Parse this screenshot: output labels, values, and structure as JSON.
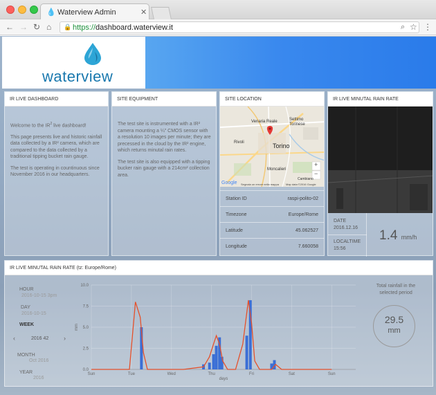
{
  "browser": {
    "tab_title": "Waterview Admin",
    "url_scheme": "https://",
    "url_host": "dashboard.waterview.it"
  },
  "header": {
    "logo_text": "waterview"
  },
  "panels": {
    "dashboard": {
      "title": "IR LIVE DASHBOARD",
      "p1_a": "Welcome to the IR",
      "p1_sup": "2",
      "p1_b": " live dashboard!",
      "p2": "This page presents live and historic rainfall data collected by a IR² camera, which are compared to the data collected by a traditional tipping bucket rain gauge.",
      "p3": "The test is operating in countinuous since November 2016 in our headquarters."
    },
    "equipment": {
      "title": "SITE EQUIPMENT",
      "p1": "The test site is instrumented with a IR² camera mounting a ¼\" CMOS sensor with a resolution 10 images per minute; they are precessed in the cloud by the IR² engine, which returns minutal rain rates.",
      "p2": "The test site is also equipped with a tipping bucker rain gauge with a 214cm² collection area."
    },
    "location": {
      "title": "SITE LOCATION",
      "map_labels": {
        "venaria": "Venaria Reale",
        "settimo": "Settimo Torinese",
        "rivoli": "Rivoli",
        "torino": "Torino",
        "moncalieri": "Moncalieri",
        "cambiano": "Cambiano",
        "google": "Google",
        "attribution": "Map data ©2016 Google",
        "error_link": "Segnala un errore nella mappa",
        "zoom_in": "+",
        "zoom_out": "−"
      },
      "rows": [
        {
          "key": "Station ID",
          "value": "raspi-polito-02"
        },
        {
          "key": "Timezone",
          "value": "Europe/Rome"
        },
        {
          "key": "Latitude",
          "value": "45.062527"
        },
        {
          "key": "Longitude",
          "value": "7.660058"
        }
      ]
    },
    "rainrate": {
      "title": "IR LIVE MINUTAL RAIN RATE",
      "date_label": "DATE",
      "date_value": "2016.12.16",
      "time_label": "LOCALTIME",
      "time_value": "15:56",
      "rate_value": "1.4",
      "rate_unit": "mm/h"
    }
  },
  "history": {
    "title": "IR LIVE MINUTAL RAIN RATE (tz: Europe/Rome)",
    "hour_label": "HOUR",
    "hour_value": "2016-10-15 3pm",
    "day_label": "DAY",
    "day_value": "2016-10-15",
    "week_label": "WEEK",
    "week_value": "2016 42",
    "prev_icon": "‹",
    "next_icon": "›",
    "month_label": "MONTH",
    "month_value": "Oct 2016",
    "year_label": "YEAR",
    "year_value": "2016",
    "total_label": "Total rainfall in the selected period",
    "total_value": "29.5",
    "total_unit": "mm"
  },
  "colors": {
    "bar": "#3b6fd6",
    "line": "#e5502a",
    "accent": "#1978ae"
  },
  "chart_data": {
    "type": "bar",
    "xlabel": "days",
    "ylabel": "mm",
    "ylim": [
      0,
      10
    ],
    "yticks": [
      "0.0",
      "2.5",
      "5.0",
      "7.5",
      "10.0"
    ],
    "x_ticks": [
      "Sun",
      "Tue",
      "Wed",
      "Thu",
      "Fri",
      "Sat",
      "Sun"
    ],
    "x_tick_positions": [
      0,
      1,
      2,
      3,
      4,
      5,
      6
    ],
    "xlim": [
      0,
      6.6
    ],
    "bars": [
      {
        "x": 1.25,
        "value": 5.0
      },
      {
        "x": 2.8,
        "value": 0.6
      },
      {
        "x": 2.95,
        "value": 0.8
      },
      {
        "x": 3.05,
        "value": 1.8
      },
      {
        "x": 3.12,
        "value": 2.8
      },
      {
        "x": 3.2,
        "value": 3.8
      },
      {
        "x": 3.26,
        "value": 1.5
      },
      {
        "x": 3.88,
        "value": 4.0
      },
      {
        "x": 3.97,
        "value": 8.2
      },
      {
        "x": 4.5,
        "value": 0.7
      },
      {
        "x": 4.57,
        "value": 1.1
      }
    ],
    "series": [
      {
        "x": [
          0,
          0.95,
          1.1,
          1.22,
          1.3,
          1.4,
          2.3,
          2.8,
          2.95,
          3.05,
          3.12,
          3.2,
          3.28,
          3.4,
          3.6,
          3.78,
          3.92,
          4.0,
          4.08,
          4.2,
          4.5,
          4.6,
          4.75,
          6.0
        ],
        "values": [
          0,
          0,
          8.0,
          6.2,
          2.0,
          0,
          0,
          0.3,
          1.5,
          3.0,
          4.0,
          3.0,
          1.0,
          0,
          0,
          3.0,
          8.2,
          5.5,
          1.0,
          0,
          0,
          0.6,
          0,
          0
        ]
      }
    ]
  }
}
